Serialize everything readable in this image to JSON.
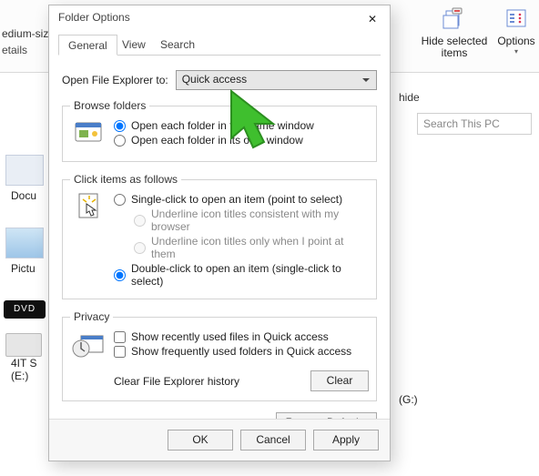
{
  "explorer": {
    "ribbon": {
      "hide_sel": "Hide selected\nitems",
      "options": "Options"
    },
    "truncated_size": "edium-siz",
    "truncated_details": "etails",
    "word_hide": "hide",
    "search_placeholder": "Search This PC",
    "side": {
      "item1": "Docu",
      "item2": "Pictu",
      "dvd_label": "DVD",
      "item3_a": "4IT S",
      "item3_b": "(E:)"
    },
    "right_drive": "(G:)"
  },
  "dialog": {
    "title": "Folder Options",
    "tabs": {
      "general": "General",
      "view": "View",
      "search": "Search"
    },
    "open_to_label": "Open File Explorer to:",
    "open_to_value": "Quick access",
    "groups": {
      "browse": {
        "legend": "Browse folders",
        "same": "Open each folder in the same window",
        "own": "Open each folder in its own window"
      },
      "click": {
        "legend": "Click items as follows",
        "single": "Single-click to open an item (point to select)",
        "under1": "Underline icon titles consistent with my browser",
        "under2": "Underline icon titles only when I point at them",
        "double": "Double-click to open an item (single-click to select)"
      },
      "privacy": {
        "legend": "Privacy",
        "recent_files": "Show recently used files in Quick access",
        "freq_folders": "Show frequently used folders in Quick access",
        "clear_label": "Clear File Explorer history",
        "clear_btn": "Clear"
      }
    },
    "restore": "Restore Defaults",
    "footer": {
      "ok": "OK",
      "cancel": "Cancel",
      "apply": "Apply"
    }
  }
}
